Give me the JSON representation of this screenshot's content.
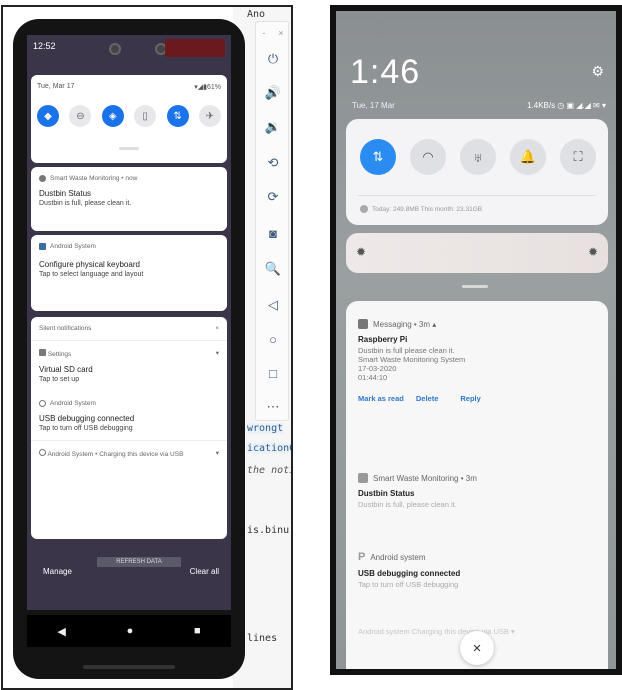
{
  "left": {
    "status_time": "12:52",
    "ide_lines": [
      {
        "text": "Ano",
        "cls": ""
      },
      {
        "text": "wrongt",
        "cls": "hl"
      },
      {
        "text": "icationC",
        "cls": "hl"
      },
      {
        "text": "the noti",
        "cls": "it"
      },
      {
        "text": "is.binu",
        "cls": ""
      },
      {
        "text": "lines",
        "cls": ""
      }
    ],
    "emulator_toolbar": {
      "head": [
        "-",
        "×"
      ],
      "buttons": [
        {
          "name": "power-icon",
          "glyph": "⏻"
        },
        {
          "name": "volume-up-icon",
          "glyph": "🔊"
        },
        {
          "name": "volume-down-icon",
          "glyph": "🔉"
        },
        {
          "name": "rotate-left-icon",
          "glyph": "⟲"
        },
        {
          "name": "rotate-right-icon",
          "glyph": "⟳"
        },
        {
          "name": "camera-icon",
          "glyph": "◙"
        },
        {
          "name": "zoom-icon",
          "glyph": "🔍"
        },
        {
          "name": "back-icon",
          "glyph": "◁"
        },
        {
          "name": "home-icon",
          "glyph": "○"
        },
        {
          "name": "overview-icon",
          "glyph": "□"
        },
        {
          "name": "more-icon",
          "glyph": "⋯"
        }
      ]
    },
    "quick_settings": {
      "date": "Tue, Mar 17",
      "battery": "▾◢▮61%",
      "tiles": [
        {
          "name": "wifi-icon",
          "glyph": "◆",
          "on": true
        },
        {
          "name": "dnd-icon",
          "glyph": "⊖",
          "on": false
        },
        {
          "name": "autorotate-icon",
          "glyph": "◈",
          "on": true
        },
        {
          "name": "battery-saver-icon",
          "glyph": "▯",
          "on": false
        },
        {
          "name": "data-icon",
          "glyph": "⇅",
          "on": true
        },
        {
          "name": "airplane-icon",
          "glyph": "✈",
          "on": false
        }
      ]
    },
    "notifications": {
      "smart_waste": {
        "app": "Smart Waste Monitoring • now",
        "title": "Dustbin Status",
        "text": "Dustbin is full, please clean it."
      },
      "keyboard": {
        "app": "Android System",
        "title": "Configure physical keyboard",
        "text": "Tap to select language and layout"
      },
      "silent_header": "Silent notifications",
      "settings": {
        "app": "Settings",
        "title": "Virtual SD card",
        "text": "Tap to set up"
      },
      "usb": {
        "app": "Android System",
        "title": "USB debugging connected",
        "text": "Tap to turn off USB debugging"
      },
      "charging": "Android System • Charging this device via USB"
    },
    "overlay_text": "REFRESH DATA",
    "manage_label": "Manage",
    "clear_label": "Clear all",
    "nav": [
      "◀",
      "●",
      "■"
    ]
  },
  "right": {
    "time": "1:46",
    "date": "Tue, 17 Mar",
    "status": "1.4KB/s ◷ ▣ ◢.◢ ✉ ▾",
    "tiles": [
      {
        "name": "data-toggle-icon",
        "glyph": "⇅",
        "on": true
      },
      {
        "name": "wifi-icon",
        "glyph": "◠",
        "on": false
      },
      {
        "name": "flashlight-icon",
        "glyph": "♅",
        "on": false
      },
      {
        "name": "bell-icon",
        "glyph": "🔔",
        "on": false
      },
      {
        "name": "screenshot-icon",
        "glyph": "⛶",
        "on": false
      }
    ],
    "data_usage": "Today: 249.8MB    This month: 23.31GB",
    "messaging": {
      "app": "Messaging • 3m ▴",
      "title": "Raspberry Pi",
      "lines": [
        "Dustbin is full please clean it.",
        "Smart Waste Monitoring System",
        "17-03-2020",
        "01:44:10"
      ],
      "actions": [
        "Mark as read",
        "Delete",
        "Reply"
      ]
    },
    "smart_waste": {
      "app": "Smart Waste Monitoring • 3m",
      "title": "Dustbin Status",
      "text": "Dustbin is full, please clean it."
    },
    "android": {
      "app": "Android system",
      "title": "USB debugging connected",
      "text": "Tap to turn off USB debugging"
    },
    "faded": "Android system   Charging this device via USB  ▾",
    "close": "×"
  }
}
